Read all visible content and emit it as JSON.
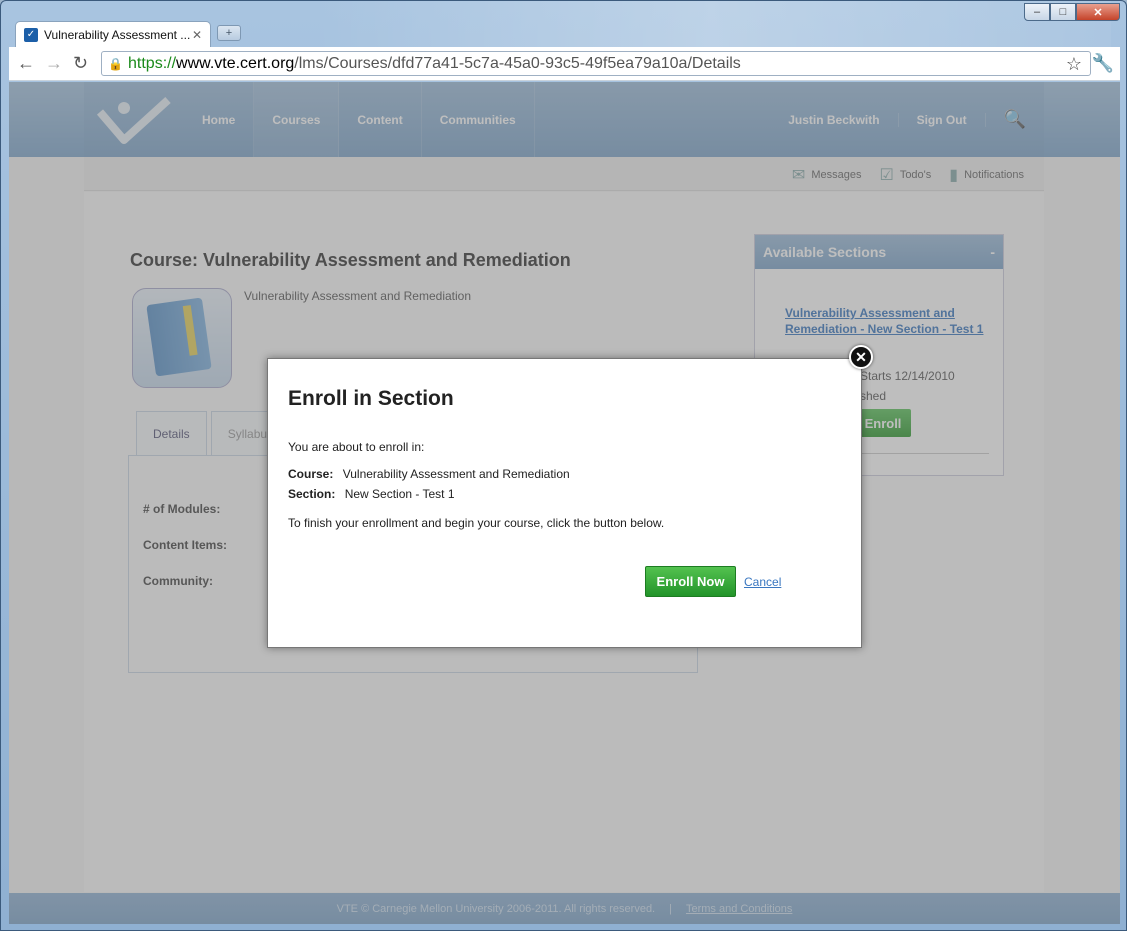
{
  "browser": {
    "tab_title": "Vulnerability Assessment ...",
    "url_scheme": "https://",
    "url_host": "www.vte.cert.org",
    "url_path": "/lms/Courses/dfd77a41-5c7a-45a0-93c5-49f5ea79a10a/Details"
  },
  "header": {
    "nav": [
      "Home",
      "Courses",
      "Content",
      "Communities"
    ],
    "user_name": "Justin Beckwith",
    "sign_out": "Sign Out"
  },
  "subbar": {
    "messages": "Messages",
    "todos": "Todo's",
    "notifications": "Notifications"
  },
  "course": {
    "title": "Course: Vulnerability Assessment and Remediation",
    "description": "Vulnerability Assessment and Remediation",
    "tabs": [
      "Details",
      "Syllabu"
    ],
    "labels": [
      "# of Modules:",
      "Content Items:",
      "Community:"
    ]
  },
  "sections_panel": {
    "title": "Available Sections",
    "collapse": "-",
    "section_link": "Vulnerability Assessment and Remediation - New Section - Test 1",
    "meta1": "Starts 12/14/2010",
    "meta2": "shed",
    "enroll": "Enroll"
  },
  "footer": {
    "copyright": "VTE © Carnegie Mellon University 2006-2011. All rights reserved.",
    "terms": "Terms and Conditions"
  },
  "modal": {
    "title": "Enroll in Section",
    "intro": "You are about to enroll in:",
    "course_label": "Course:",
    "course_value": "Vulnerability Assessment and Remediation",
    "section_label": "Section:",
    "section_value": "New Section - Test 1",
    "finish": "To finish your enrollment and begin your course, click the button below.",
    "enroll_now": "Enroll Now",
    "cancel": "Cancel"
  }
}
